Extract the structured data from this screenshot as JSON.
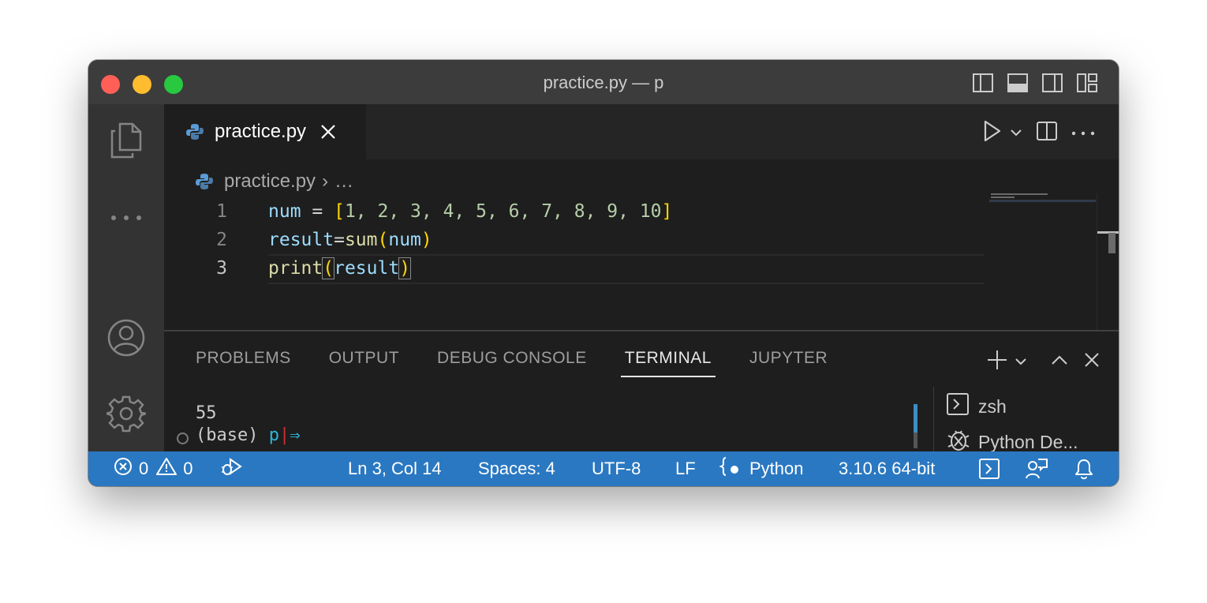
{
  "window": {
    "title": "practice.py — p"
  },
  "tab": {
    "label": "practice.py"
  },
  "breadcrumb": {
    "file": "practice.py",
    "ellipsis": "…",
    "separator": "›"
  },
  "editor": {
    "lines": [
      {
        "number": "1"
      },
      {
        "number": "2"
      },
      {
        "number": "3"
      }
    ],
    "code": {
      "l1": {
        "var": "num",
        "eq": " = ",
        "open": "[",
        "items": "1, 2, 3, 4, 5, 6, 7, 8, 9, 10",
        "close": "]"
      },
      "l2": {
        "var": "result",
        "eq": "=",
        "fn": "sum",
        "open": "(",
        "arg": "num",
        "close": ")"
      },
      "l3": {
        "fn": "print",
        "open": "(",
        "arg": "result",
        "close": ")"
      }
    }
  },
  "panel": {
    "tabs": {
      "problems": "PROBLEMS",
      "output": "OUTPUT",
      "debug": "DEBUG CONSOLE",
      "terminal": "TERMINAL",
      "jupyter": "JUPYTER"
    },
    "terminal": {
      "output": "55",
      "prompt_env": "(base)",
      "prompt_dir": "p",
      "prompt_sep": "|",
      "prompt_arrow": "⇒"
    },
    "terminals": {
      "zsh": "zsh",
      "python": "Python De..."
    }
  },
  "statusbar": {
    "errors": "0",
    "warnings": "0",
    "position": "Ln 3, Col 14",
    "spaces": "Spaces: 4",
    "encoding": "UTF-8",
    "eol": "LF",
    "language": "Python",
    "interpreter": "3.10.6 64-bit"
  },
  "colors": {
    "accent": "#2a78c2",
    "background": "#1e1e1e",
    "titlebar": "#3c3c3c"
  }
}
